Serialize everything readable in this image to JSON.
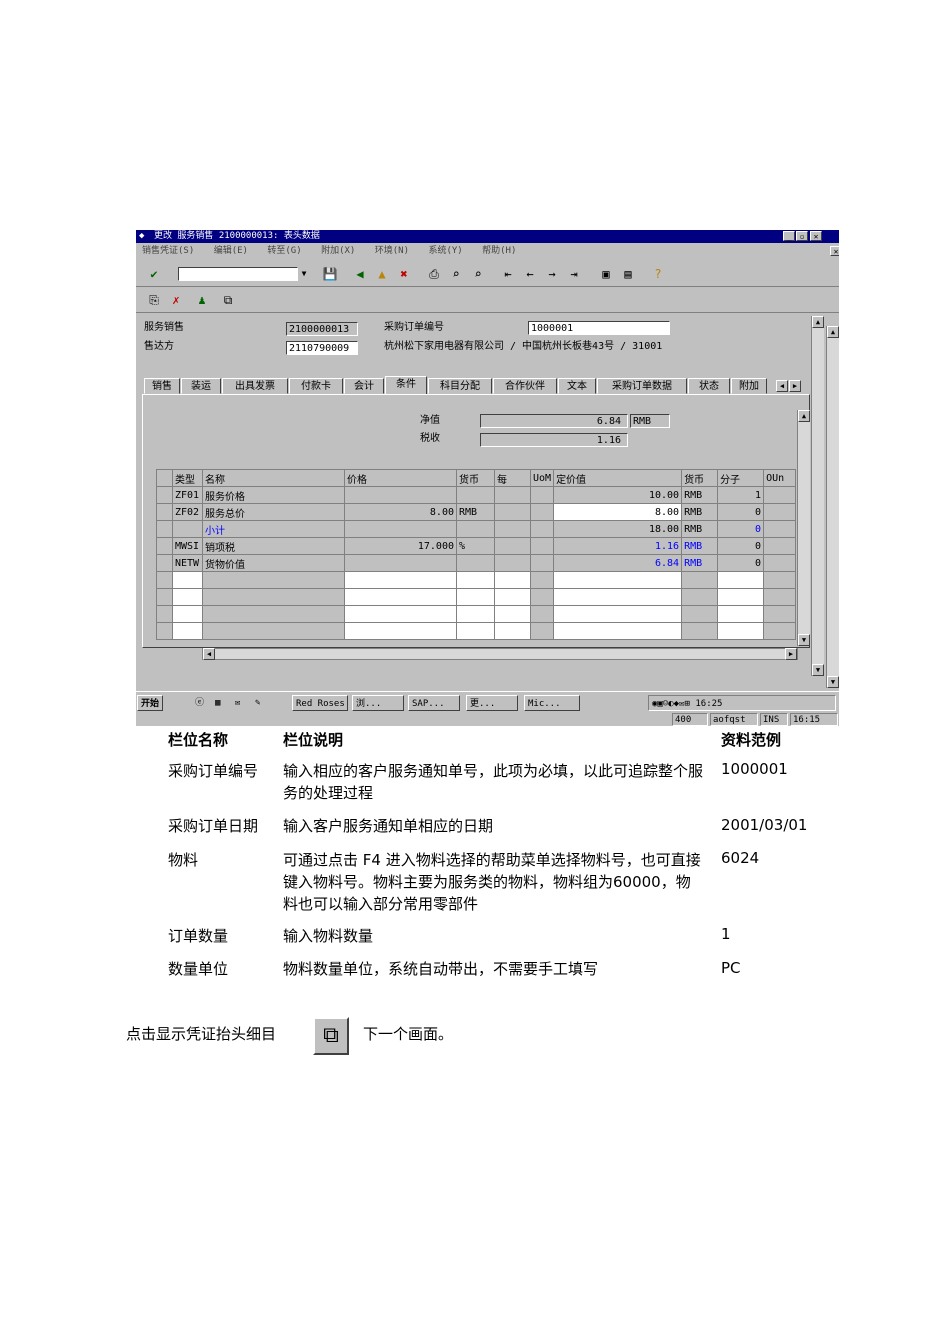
{
  "sap_window": {
    "title": "更改 服务销售 2100000013: 表头数据",
    "menu": [
      "销售凭证(S)",
      "编辑(E)",
      "转至(G)",
      "附加(X)",
      "环境(N)",
      "系统(Y)",
      "帮助(H)"
    ],
    "header": {
      "label_doc": "服务销售",
      "doc_no": "2100000013",
      "label_po": "采购订单编号",
      "po_no": "1000001",
      "label_shipto": "售达方",
      "shipto_no": "2110790009",
      "shipto_addr": "杭州松下家用电器有限公司 / 中国杭州长板巷43号 / 31001"
    },
    "tabs": [
      "销售",
      "装运",
      "出具发票",
      "付款卡",
      "会计",
      "条件",
      "科目分配",
      "合作伙伴",
      "文本",
      "采购订单数据",
      "状态",
      "附加"
    ],
    "active_tab": "条件",
    "net_label": "净值",
    "net_value": "6.84",
    "net_currency": "RMB",
    "tax_label": "税收",
    "tax_value": "1.16",
    "grid": {
      "headers": [
        "类型",
        "名称",
        "价格",
        "货币",
        "每",
        "UoM",
        "定价值",
        "货币",
        "分子",
        "OUn"
      ],
      "rows": [
        [
          "ZF01",
          "服务价格",
          "",
          "",
          "",
          "",
          "10.00",
          "RMB",
          "1",
          ""
        ],
        [
          "ZF02",
          "服务总价",
          "8.00",
          "RMB",
          "",
          "",
          "8.00",
          "RMB",
          "0",
          ""
        ],
        [
          "",
          "小计",
          "",
          "",
          "",
          "",
          "18.00",
          "RMB",
          "0",
          ""
        ],
        [
          "MWSI",
          "销项税",
          "17.000",
          "%",
          "",
          "",
          "1.16",
          "RMB",
          "0",
          ""
        ],
        [
          "NETW",
          "货物价值",
          "",
          "",
          "",
          "",
          "6.84",
          "RMB",
          "0",
          ""
        ]
      ]
    },
    "taskbar": {
      "start": "开始",
      "items": [
        "Red Roses",
        "浏...",
        "SAP...",
        "更...",
        "Mic..."
      ],
      "clock": "16:25"
    },
    "status": {
      "client": "400",
      "server": "aofqst",
      "mode": "INS",
      "time": "16:15"
    }
  },
  "field_table": {
    "headers": [
      "栏位名称",
      "栏位说明",
      "资料范例"
    ],
    "rows": [
      [
        "采购订单编号",
        "输入相应的客户服务通知单号，此项为必填，以此可追踪整个服务的处理过程",
        "1000001"
      ],
      [
        "采购订单日期",
        "输入客户服务通知单相应的日期",
        "2001/03/01"
      ],
      [
        "物料",
        "可通过点击 F4 进入物料选择的帮助菜单选择物料号，也可直接键入物料号。物料主要为服务类的物料，物料组为60000，物料也可以输入部分常用零部件",
        "6024"
      ],
      [
        "订单数量",
        "输入物料数量",
        "1"
      ],
      [
        "数量单位",
        "物料数量单位，系统自动带出，不需要手工填写",
        "PC"
      ]
    ]
  },
  "instruction": {
    "before": "点击显示凭证抬头细目",
    "after": "下一个画面。"
  }
}
